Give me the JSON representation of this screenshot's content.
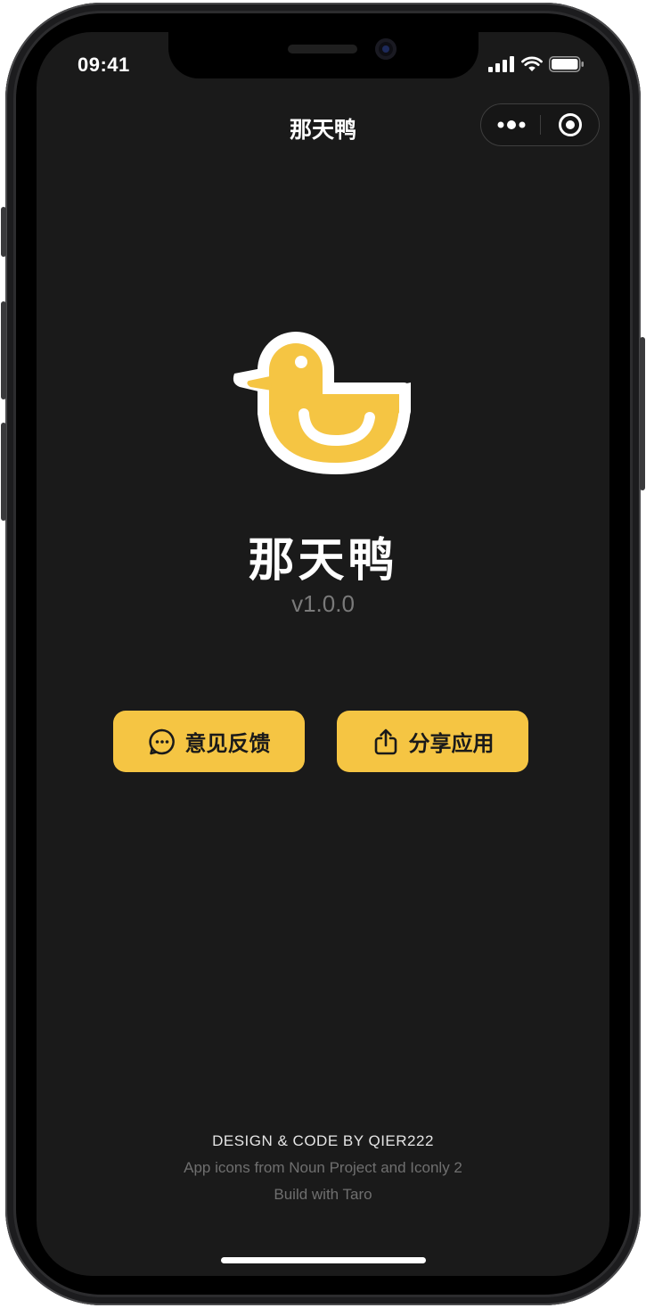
{
  "status_bar": {
    "time": "09:41"
  },
  "nav": {
    "title": "那天鸭",
    "more_icon": "more-dots-icon",
    "close_icon": "target-close-icon"
  },
  "app": {
    "logo_icon": "duck-icon",
    "name": "那天鸭",
    "version": "v1.0.0",
    "accent_color": "#f5c543"
  },
  "actions": {
    "feedback_label": "意见反馈",
    "feedback_icon": "chat-bubble-icon",
    "share_label": "分享应用",
    "share_icon": "share-upload-icon"
  },
  "footer": {
    "credit": "DESIGN & CODE BY QIER222",
    "icons_credit": "App icons from Noun Project and Iconly 2",
    "build_credit": "Build with Taro"
  }
}
